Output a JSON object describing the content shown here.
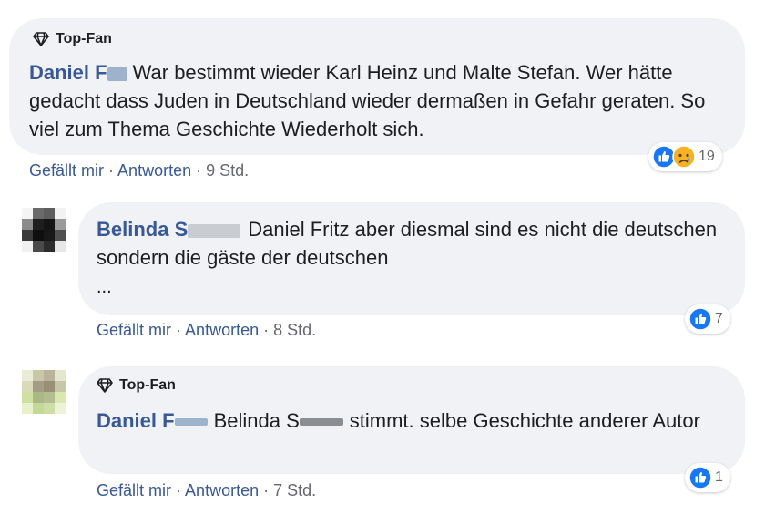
{
  "comments": [
    {
      "badge": "Top-Fan",
      "author_visible": "Daniel F",
      "text": "War bestimmt wieder Karl Heinz und Malte Stefan. Wer hätte gedacht dass Juden in Deutschland wieder dermaßen in Gefahr geraten. So viel zum Thema Geschichte Wiederholt sich.",
      "like_label": "Gefällt mir",
      "reply_label": "Antworten",
      "time": "9 Std.",
      "reactions": [
        "like-icon",
        "sad-icon"
      ],
      "reaction_count": "19"
    },
    {
      "author_visible": "Belinda S",
      "text": "Daniel Fritz aber diesmal sind es nicht die deutschen sondern die gäste der deutschen",
      "more": "...",
      "like_label": "Gefällt mir",
      "reply_label": "Antworten",
      "time": "8 Std.",
      "reactions": [
        "like-icon"
      ],
      "reaction_count": "7"
    },
    {
      "badge": "Top-Fan",
      "author_visible": "Daniel F",
      "mention_visible": "Belinda S",
      "text": "stimmt. selbe Geschichte anderer Autor",
      "like_label": "Gefällt mir",
      "reply_label": "Antworten",
      "time": "7 Std.",
      "reactions": [
        "like-icon"
      ],
      "reaction_count": "1"
    }
  ],
  "separator": "·",
  "colors": {
    "bubble": "#f0f2f5",
    "link": "#385898",
    "meta": "#65676b",
    "like": "#1877f2"
  }
}
